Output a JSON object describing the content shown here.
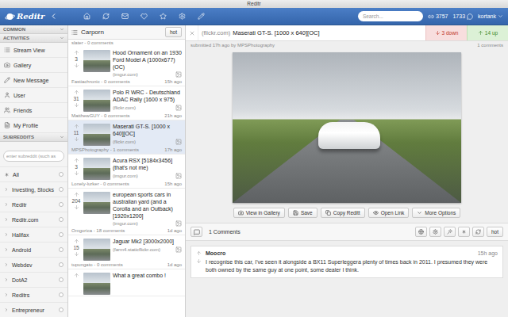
{
  "window": {
    "title": "Reditr"
  },
  "toolbar": {
    "logo": "Reditr",
    "search": {
      "placeholder": "Search..."
    },
    "link_karma": "3757",
    "comment_karma": "1733",
    "user": "kortank"
  },
  "sidebar": {
    "common": {
      "title": "COMMON"
    },
    "activities": {
      "title": "ACTIVITIES",
      "items": [
        "Stream View",
        "Gallery",
        "New Message",
        "User",
        "Friends",
        "My Profile"
      ]
    },
    "subreddits": {
      "title": "SUBREDDITS",
      "search_placeholder": "enter subreddit (such as",
      "items": [
        {
          "name": "All",
          "kind": "all"
        },
        {
          "name": "Investing, Stocks",
          "kind": "subreddit"
        },
        {
          "name": "Reditr",
          "kind": "subreddit"
        },
        {
          "name": "Reditr.com",
          "kind": "subreddit"
        },
        {
          "name": "Halifax",
          "kind": "subreddit"
        },
        {
          "name": "Android",
          "kind": "subreddit"
        },
        {
          "name": "Webdev",
          "kind": "subreddit"
        },
        {
          "name": "DotA2",
          "kind": "subreddit"
        },
        {
          "name": "Reditrs",
          "kind": "subreddit"
        },
        {
          "name": "Entrepreneur",
          "kind": "subreddit"
        }
      ]
    }
  },
  "post_list": {
    "title": "Carporn",
    "sort": "hot",
    "cut_meta": "slater - 0 comments",
    "posts": [
      {
        "votes": "3",
        "title": "Hood Ornament on an 1930 Ford Model A (1000x677) (OC)",
        "domain": "(imgur.com)",
        "meta": "Fastiachronic - 0 comments",
        "time": "15h ago",
        "selected": false
      },
      {
        "votes": "31",
        "title": "Polo R WRC - Deutschland ADAC Rally (1600 x 975)",
        "domain": "(flickr.com)",
        "meta": "MatthewGUY - 0 comments",
        "time": "21h ago",
        "selected": false
      },
      {
        "votes": "11",
        "title": "Maserati GT-S. [1000 x 640][OC]",
        "domain": "(flickr.com)",
        "meta": "MPSPhotography - 1 comments",
        "time": "17h ago",
        "selected": true
      },
      {
        "votes": "3",
        "title": "Acura RSX [5184x3456] (that's not me)",
        "domain": "(imgur.com)",
        "meta": "Lonely-lurker - 0 comments",
        "time": "15h ago",
        "selected": false
      },
      {
        "votes": "204",
        "title": "european sports cars in australian yard (and a Corolla and an Outback) [1920x1200]",
        "domain": "(imgur.com)",
        "meta": "Omgorica - 18 comments",
        "time": "1d ago",
        "selected": false
      },
      {
        "votes": "15",
        "title": "Jaguar Mk2 [3000x2000]",
        "domain": "(farm4.staticflickr.com)",
        "meta": "tupungato - 0 comments",
        "time": "1d ago",
        "selected": false
      },
      {
        "title": "What a great combo !",
        "selected": false
      }
    ]
  },
  "post_view": {
    "domain": "(flickr.com)",
    "title": "Maserati GT-S. [1000 x 640][OC]",
    "votes": [
      {
        "label": "3 down",
        "kind": "down"
      },
      {
        "label": "14 up",
        "kind": "up"
      }
    ],
    "submitted": "submitted 17h ago by MPSPhotography",
    "comments_link": "1 comments",
    "actions": [
      "View in Gallery",
      "Save",
      "Copy Reditt",
      "Open Link",
      "More Options"
    ]
  },
  "comments": {
    "count": "1 Comments",
    "sort": "hot",
    "items": [
      {
        "author": "Moocro",
        "time": "15h ago",
        "text": "I recognise this car, I've seen it alongside a BX11 Superleggera plenty of times back in 2011. I presumed they were both owned by the same guy at one point, some dealer I think."
      }
    ]
  }
}
